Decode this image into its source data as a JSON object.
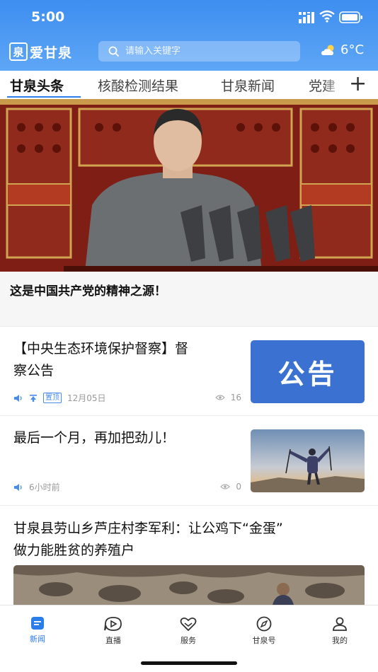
{
  "status_bar": {
    "time": "5:00"
  },
  "header": {
    "logo_glyph": "泉",
    "app_name": "爱甘泉",
    "search_placeholder": "请输入关键字",
    "weather": {
      "temperature": "6°C",
      "icon": "partly-cloudy-icon"
    }
  },
  "tabs": [
    {
      "label": "甘泉头条",
      "active": true
    },
    {
      "label": "核酸检测结果",
      "active": false
    },
    {
      "label": "甘泉新闻",
      "active": false
    },
    {
      "label": "党建",
      "active": false
    }
  ],
  "hero": {
    "caption": "这是中国共产党的精神之源！"
  },
  "feed": [
    {
      "title_line1": "【中央生态环境保护督察】督",
      "title_line2": "察公告",
      "badge": "置顶",
      "date": "12月05日",
      "views": "16",
      "thumb_text": "公告"
    },
    {
      "title_line1": "最后一个月，再加把劲儿！",
      "time": "6小时前",
      "views": "0"
    },
    {
      "title_line1": "甘泉县劳山乡芦庄村李军利：让公鸡下“金蛋”",
      "title_line2": "做力能胜贫的养殖户"
    }
  ],
  "bottom_nav": [
    {
      "label": "新闻",
      "icon": "news-icon",
      "active": true
    },
    {
      "label": "直播",
      "icon": "live-play-icon",
      "active": false
    },
    {
      "label": "服务",
      "icon": "service-heart-icon",
      "active": false
    },
    {
      "label": "甘泉号",
      "icon": "compass-icon",
      "active": false
    },
    {
      "label": "我的",
      "icon": "profile-icon",
      "active": false
    }
  ],
  "colors": {
    "accent": "#2b7de9",
    "header": "#4a97f2"
  }
}
